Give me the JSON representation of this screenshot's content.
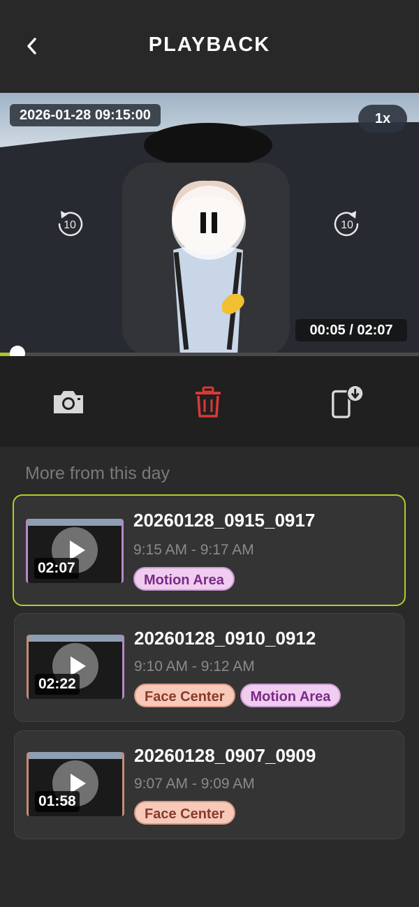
{
  "header": {
    "title": "PLAYBACK",
    "back_icon": "chevron-left-icon"
  },
  "player": {
    "timestamp": "2026-01-28 09:15:00",
    "speed": "1x",
    "time": "00:05 / 02:07",
    "progress": 0.04,
    "rewind_label": "10",
    "forward_label": "10",
    "accent_color": "#a8c82a"
  },
  "toolbar": {
    "snapshot_icon": "camera-icon",
    "delete_icon": "trash-icon",
    "download_icon": "phone-download-icon",
    "delete_color": "#d93a36"
  },
  "section": {
    "title": "More from this day"
  },
  "clips": [
    {
      "name": "20260128_0915_0917",
      "time": "9:15 AM - 9:17 AM",
      "duration": "02:07",
      "tags": [
        "Motion Area"
      ],
      "selected": true
    },
    {
      "name": "20260128_0910_0912",
      "time": "9:10 AM - 9:12 AM",
      "duration": "02:22",
      "tags": [
        "Face Center",
        "Motion Area"
      ],
      "selected": false
    },
    {
      "name": "20260128_0907_0909",
      "time": "9:07 AM - 9:09 AM",
      "duration": "01:58",
      "tags": [
        "Face Center"
      ],
      "selected": false
    }
  ]
}
